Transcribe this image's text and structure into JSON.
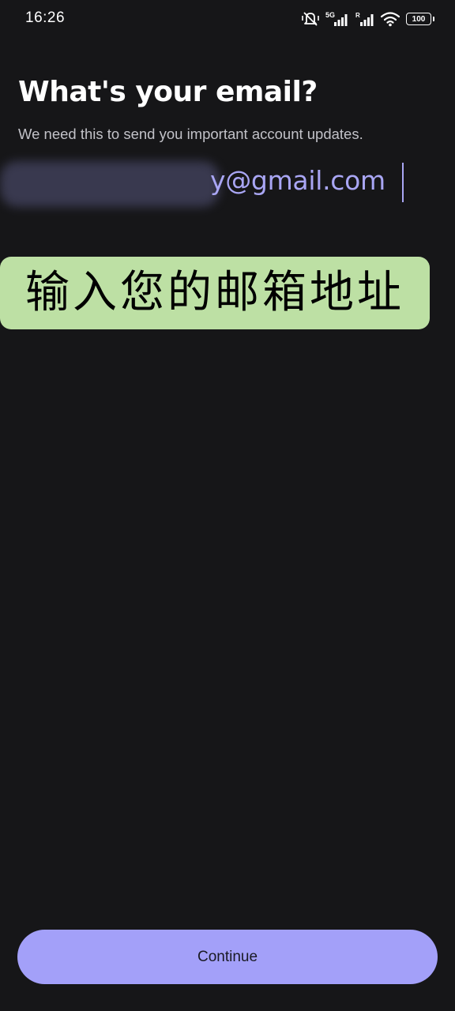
{
  "status_bar": {
    "time": "16:26",
    "icons": [
      "mute-vibrate-icon",
      "signal-5g-icon",
      "signal-roaming-icon",
      "wifi-icon",
      "battery-icon"
    ],
    "network_label": "5G",
    "roaming_label": "R",
    "battery_level": "100"
  },
  "header": {
    "title": "What's your email?",
    "subtitle": "We need this to send you important account updates."
  },
  "email_field": {
    "visible_value": "y@gmail.com",
    "text_color": "#a9a6f4",
    "focused": true
  },
  "overlay": {
    "text": "输入您的邮箱地址",
    "background": "#bde0a4"
  },
  "footer": {
    "continue_label": "Continue",
    "button_color": "#a3a0f9"
  },
  "theme": {
    "background": "#161618"
  }
}
